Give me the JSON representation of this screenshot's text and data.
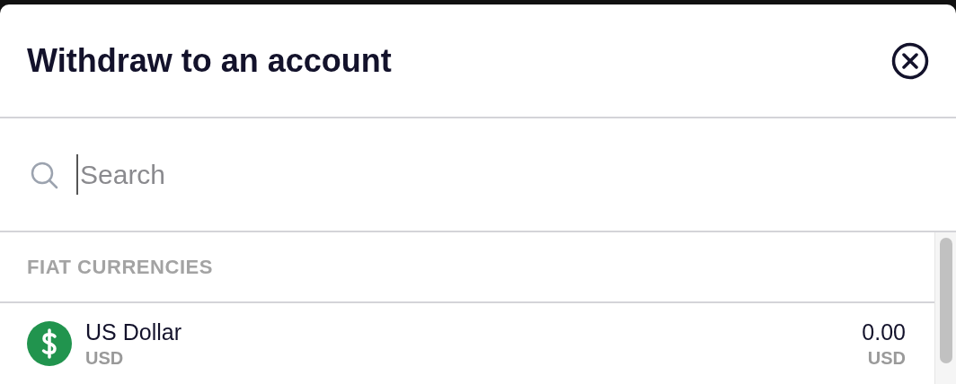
{
  "dialog": {
    "title": "Withdraw to an account"
  },
  "search": {
    "placeholder": "Search"
  },
  "sections": [
    {
      "heading": "FIAT CURRENCIES",
      "items": [
        {
          "name": "US Dollar",
          "code": "USD",
          "balance": "0.00",
          "balance_unit": "USD",
          "color": "#21944e"
        }
      ]
    }
  ]
}
